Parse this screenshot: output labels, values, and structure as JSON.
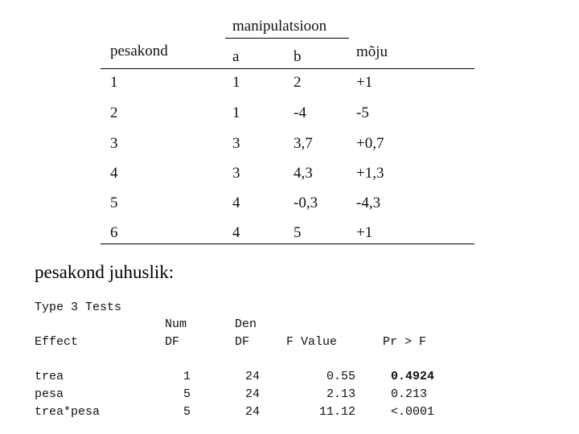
{
  "table": {
    "group_header": "manipulatsioon",
    "headers": {
      "pesakond": "pesakond",
      "a": "a",
      "b": "b",
      "moju": "mõju"
    },
    "rows": [
      {
        "pesakond": "1",
        "a": "1",
        "b": "2",
        "moju": "+1"
      },
      {
        "pesakond": "2",
        "a": "1",
        "b": "-4",
        "moju": "-5"
      },
      {
        "pesakond": "3",
        "a": "3",
        "b": "3,7",
        "moju": "+0,7"
      },
      {
        "pesakond": "4",
        "a": "3",
        "b": "4,3",
        "moju": "+1,3"
      },
      {
        "pesakond": "5",
        "a": "4",
        "b": "-0,3",
        "moju": "-4,3"
      },
      {
        "pesakond": "6",
        "a": "4",
        "b": "5",
        "moju": "+1"
      }
    ]
  },
  "section_title": "pesakond juhuslik:",
  "sas_output": {
    "title": "Type 3 Tests",
    "headers": {
      "effect": "Effect",
      "num_top": "Num",
      "num_bottom": "DF",
      "den_top": "Den",
      "den_bottom": "DF",
      "fvalue": "F Value",
      "pr": "Pr > F"
    },
    "rows": [
      {
        "effect": "trea",
        "num_df": "1",
        "den_df": "24",
        "fvalue": "0.55",
        "pr": "0.4924",
        "pr_bold": true
      },
      {
        "effect": "pesa",
        "num_df": "5",
        "den_df": "24",
        "fvalue": "2.13",
        "pr": "0.213",
        "pr_bold": false
      },
      {
        "effect": "trea*pesa",
        "num_df": "5",
        "den_df": "24",
        "fvalue": "11.12",
        "pr": "<.0001",
        "pr_bold": false
      }
    ]
  }
}
